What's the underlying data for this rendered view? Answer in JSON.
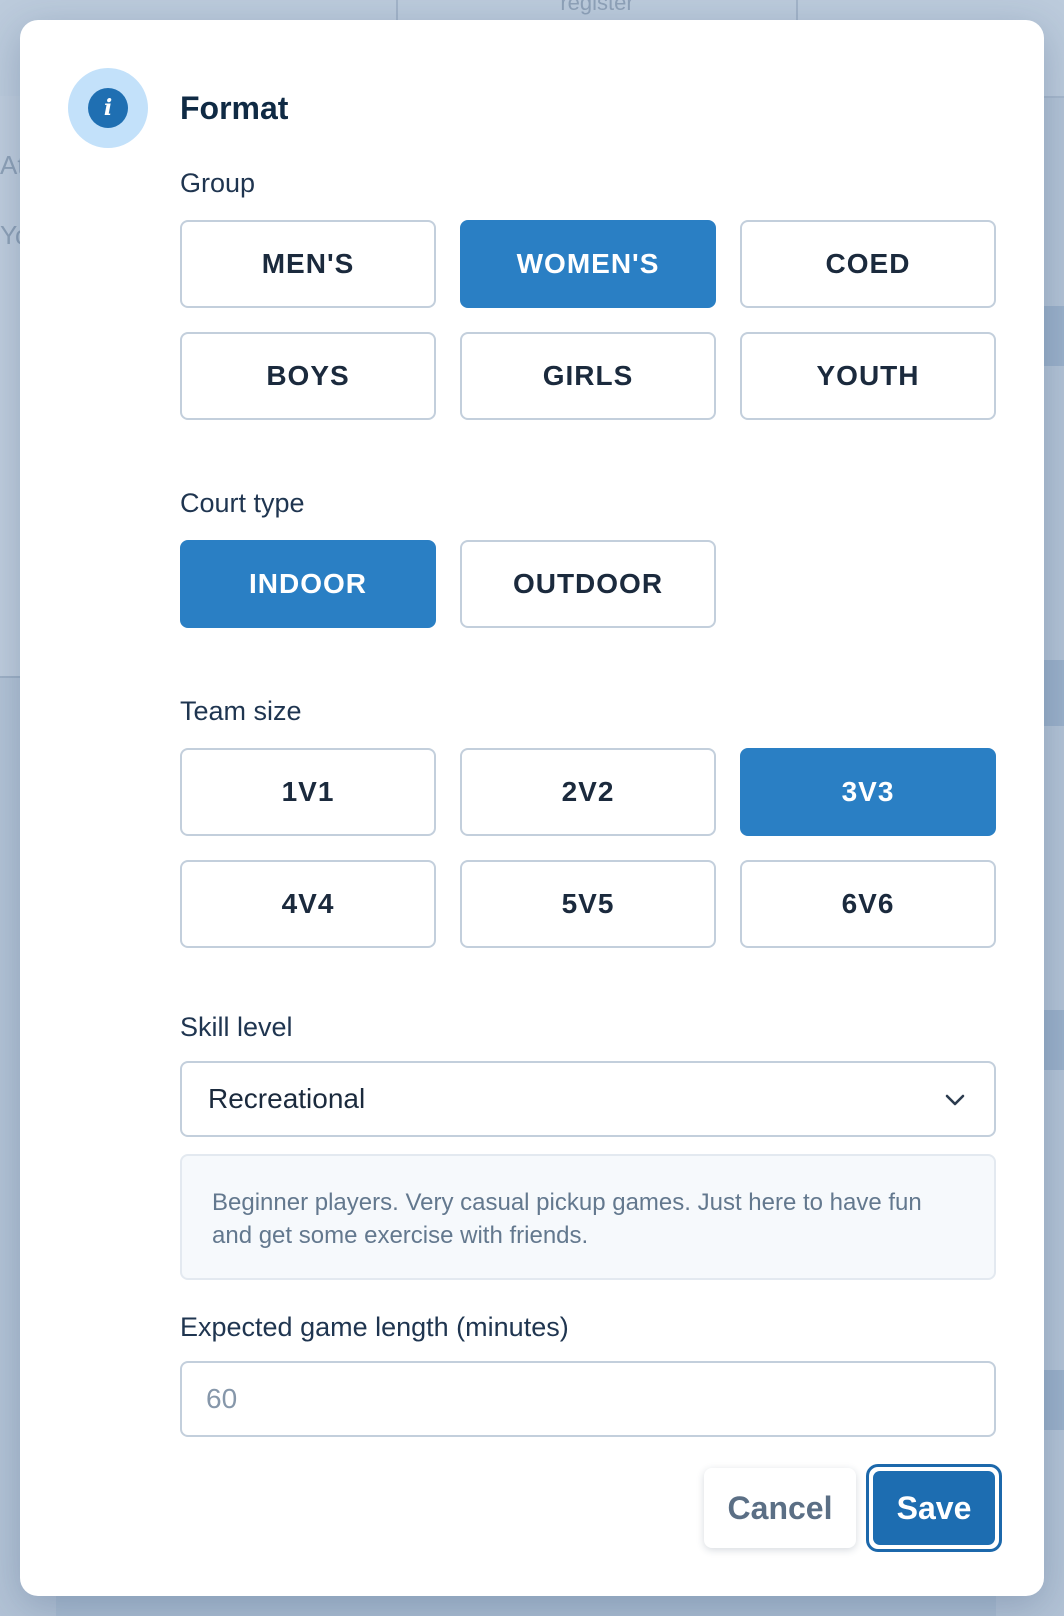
{
  "background": {
    "tab_text": "register",
    "side_letters": [
      "At",
      "Yo"
    ]
  },
  "modal": {
    "title": "Format",
    "info_icon": "info-icon",
    "group": {
      "label": "Group",
      "options": [
        "MEN'S",
        "WOMEN'S",
        "COED",
        "BOYS",
        "GIRLS",
        "YOUTH"
      ],
      "selected": "WOMEN'S"
    },
    "court_type": {
      "label": "Court type",
      "options": [
        "INDOOR",
        "OUTDOOR"
      ],
      "selected": "INDOOR"
    },
    "team_size": {
      "label": "Team size",
      "options": [
        "1V1",
        "2V2",
        "3V3",
        "4V4",
        "5V5",
        "6V6"
      ],
      "selected": "3V3"
    },
    "skill_level": {
      "label": "Skill level",
      "value": "Recreational",
      "description": "Beginner players. Very casual pickup games. Just here to have fun and get some exercise with friends."
    },
    "game_length": {
      "label": "Expected game length (minutes)",
      "placeholder": "60",
      "value": ""
    },
    "actions": {
      "cancel_label": "Cancel",
      "save_label": "Save"
    }
  },
  "colors": {
    "accent": "#2a7fc4",
    "primary_button": "#1d6db1",
    "badge_bg": "#c3e1fa"
  }
}
